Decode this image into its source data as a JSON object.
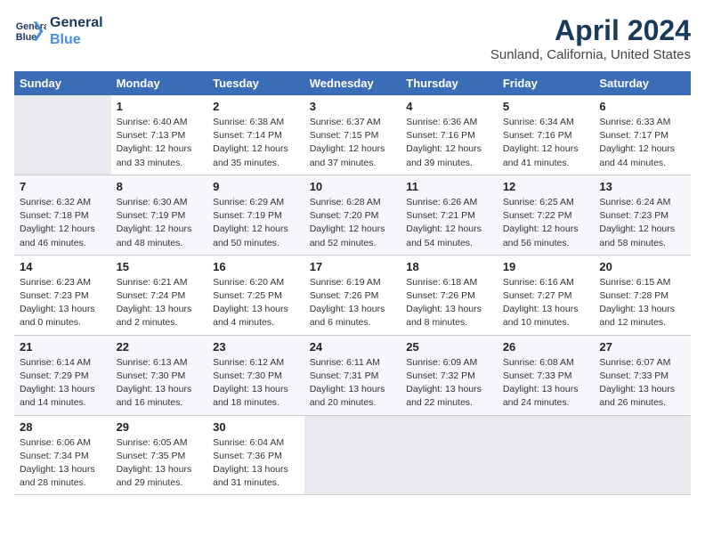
{
  "logo": {
    "line1": "General",
    "line2": "Blue"
  },
  "title": "April 2024",
  "subtitle": "Sunland, California, United States",
  "days_of_week": [
    "Sunday",
    "Monday",
    "Tuesday",
    "Wednesday",
    "Thursday",
    "Friday",
    "Saturday"
  ],
  "weeks": [
    [
      {
        "day": "",
        "info": ""
      },
      {
        "day": "1",
        "info": "Sunrise: 6:40 AM\nSunset: 7:13 PM\nDaylight: 12 hours\nand 33 minutes."
      },
      {
        "day": "2",
        "info": "Sunrise: 6:38 AM\nSunset: 7:14 PM\nDaylight: 12 hours\nand 35 minutes."
      },
      {
        "day": "3",
        "info": "Sunrise: 6:37 AM\nSunset: 7:15 PM\nDaylight: 12 hours\nand 37 minutes."
      },
      {
        "day": "4",
        "info": "Sunrise: 6:36 AM\nSunset: 7:16 PM\nDaylight: 12 hours\nand 39 minutes."
      },
      {
        "day": "5",
        "info": "Sunrise: 6:34 AM\nSunset: 7:16 PM\nDaylight: 12 hours\nand 41 minutes."
      },
      {
        "day": "6",
        "info": "Sunrise: 6:33 AM\nSunset: 7:17 PM\nDaylight: 12 hours\nand 44 minutes."
      }
    ],
    [
      {
        "day": "7",
        "info": "Sunrise: 6:32 AM\nSunset: 7:18 PM\nDaylight: 12 hours\nand 46 minutes."
      },
      {
        "day": "8",
        "info": "Sunrise: 6:30 AM\nSunset: 7:19 PM\nDaylight: 12 hours\nand 48 minutes."
      },
      {
        "day": "9",
        "info": "Sunrise: 6:29 AM\nSunset: 7:19 PM\nDaylight: 12 hours\nand 50 minutes."
      },
      {
        "day": "10",
        "info": "Sunrise: 6:28 AM\nSunset: 7:20 PM\nDaylight: 12 hours\nand 52 minutes."
      },
      {
        "day": "11",
        "info": "Sunrise: 6:26 AM\nSunset: 7:21 PM\nDaylight: 12 hours\nand 54 minutes."
      },
      {
        "day": "12",
        "info": "Sunrise: 6:25 AM\nSunset: 7:22 PM\nDaylight: 12 hours\nand 56 minutes."
      },
      {
        "day": "13",
        "info": "Sunrise: 6:24 AM\nSunset: 7:23 PM\nDaylight: 12 hours\nand 58 minutes."
      }
    ],
    [
      {
        "day": "14",
        "info": "Sunrise: 6:23 AM\nSunset: 7:23 PM\nDaylight: 13 hours\nand 0 minutes."
      },
      {
        "day": "15",
        "info": "Sunrise: 6:21 AM\nSunset: 7:24 PM\nDaylight: 13 hours\nand 2 minutes."
      },
      {
        "day": "16",
        "info": "Sunrise: 6:20 AM\nSunset: 7:25 PM\nDaylight: 13 hours\nand 4 minutes."
      },
      {
        "day": "17",
        "info": "Sunrise: 6:19 AM\nSunset: 7:26 PM\nDaylight: 13 hours\nand 6 minutes."
      },
      {
        "day": "18",
        "info": "Sunrise: 6:18 AM\nSunset: 7:26 PM\nDaylight: 13 hours\nand 8 minutes."
      },
      {
        "day": "19",
        "info": "Sunrise: 6:16 AM\nSunset: 7:27 PM\nDaylight: 13 hours\nand 10 minutes."
      },
      {
        "day": "20",
        "info": "Sunrise: 6:15 AM\nSunset: 7:28 PM\nDaylight: 13 hours\nand 12 minutes."
      }
    ],
    [
      {
        "day": "21",
        "info": "Sunrise: 6:14 AM\nSunset: 7:29 PM\nDaylight: 13 hours\nand 14 minutes."
      },
      {
        "day": "22",
        "info": "Sunrise: 6:13 AM\nSunset: 7:30 PM\nDaylight: 13 hours\nand 16 minutes."
      },
      {
        "day": "23",
        "info": "Sunrise: 6:12 AM\nSunset: 7:30 PM\nDaylight: 13 hours\nand 18 minutes."
      },
      {
        "day": "24",
        "info": "Sunrise: 6:11 AM\nSunset: 7:31 PM\nDaylight: 13 hours\nand 20 minutes."
      },
      {
        "day": "25",
        "info": "Sunrise: 6:09 AM\nSunset: 7:32 PM\nDaylight: 13 hours\nand 22 minutes."
      },
      {
        "day": "26",
        "info": "Sunrise: 6:08 AM\nSunset: 7:33 PM\nDaylight: 13 hours\nand 24 minutes."
      },
      {
        "day": "27",
        "info": "Sunrise: 6:07 AM\nSunset: 7:33 PM\nDaylight: 13 hours\nand 26 minutes."
      }
    ],
    [
      {
        "day": "28",
        "info": "Sunrise: 6:06 AM\nSunset: 7:34 PM\nDaylight: 13 hours\nand 28 minutes."
      },
      {
        "day": "29",
        "info": "Sunrise: 6:05 AM\nSunset: 7:35 PM\nDaylight: 13 hours\nand 29 minutes."
      },
      {
        "day": "30",
        "info": "Sunrise: 6:04 AM\nSunset: 7:36 PM\nDaylight: 13 hours\nand 31 minutes."
      },
      {
        "day": "",
        "info": ""
      },
      {
        "day": "",
        "info": ""
      },
      {
        "day": "",
        "info": ""
      },
      {
        "day": "",
        "info": ""
      }
    ]
  ]
}
